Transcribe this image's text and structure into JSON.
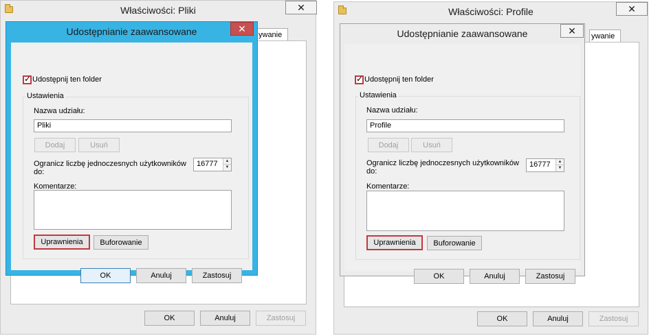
{
  "left": {
    "window_title": "Właściwości: Pliki",
    "tab_partial": "ywanie",
    "ok": "OK",
    "cancel": "Anuluj",
    "apply": "Zastosuj",
    "dialog": {
      "title": "Udostępnianie zaawansowane",
      "share_checkbox_label": "Udostępnij ten folder",
      "share_checked": true,
      "settings_group": "Ustawienia",
      "share_name_label": "Nazwa udziału:",
      "share_name_value": "Pliki",
      "add": "Dodaj",
      "remove": "Usuń",
      "limit_label_line1": "Ogranicz liczbę jednoczesnych użytkowników",
      "limit_label_line2": "do:",
      "limit_value": "16777",
      "comments_label": "Komentarze:",
      "permissions": "Uprawnienia",
      "caching": "Buforowanie",
      "ok": "OK",
      "cancel": "Anuluj",
      "apply": "Zastosuj"
    }
  },
  "right": {
    "window_title": "Właściwości: Profile",
    "tab_partial": "ywanie",
    "ok": "OK",
    "cancel": "Anuluj",
    "apply": "Zastosuj",
    "dialog": {
      "title": "Udostępnianie zaawansowane",
      "share_checkbox_label": "Udostępnij ten folder",
      "share_checked": true,
      "settings_group": "Ustawienia",
      "share_name_label": "Nazwa udziału:",
      "share_name_value": "Profile",
      "add": "Dodaj",
      "remove": "Usuń",
      "limit_label_line1": "Ogranicz liczbę jednoczesnych użytkowników",
      "limit_label_line2": "do:",
      "limit_value": "16777",
      "comments_label": "Komentarze:",
      "permissions": "Uprawnienia",
      "caching": "Buforowanie",
      "ok": "OK",
      "cancel": "Anuluj",
      "apply": "Zastosuj"
    }
  },
  "icons": {
    "close": "✕",
    "checkmark": "✓",
    "spin_up": "▲",
    "spin_down": "▼",
    "folder": "folder-icon"
  },
  "colors": {
    "active_dialog_frame": "#38b4e4",
    "close_button_red": "#c75050",
    "highlight_border": "#c0393f"
  }
}
